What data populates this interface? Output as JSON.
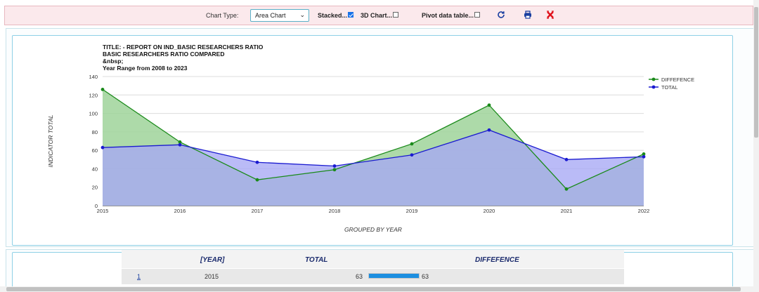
{
  "toolbar": {
    "chart_type_label": "Chart Type:",
    "chart_type_value": "Area Chart",
    "stacked_label": "Stacked...",
    "stacked_checked": true,
    "chart3d_label": "3D Chart...",
    "chart3d_checked": false,
    "pivot_label": "Pivot data table...",
    "pivot_checked": false,
    "icons": [
      "refresh-icon",
      "print-icon",
      "close-icon"
    ]
  },
  "chart": {
    "title_lines": [
      "TITLE: - REPORT ON IND_BASIC RESEARCHERS RATIO",
      "BASIC RESEARCHERS RATIO COMPARED",
      "&nbsp;",
      "Year Range from 2008 to 2023"
    ]
  },
  "chart_data": {
    "type": "area",
    "title": "TITLE: - REPORT ON IND_BASIC RESEARCHERS RATIO",
    "xlabel": "GROUPED BY YEAR",
    "ylabel": "INDICATOR TOTAL",
    "categories": [
      "2015",
      "2016",
      "2017",
      "2018",
      "2019",
      "2020",
      "2021",
      "2022"
    ],
    "ylim": [
      0,
      140
    ],
    "yticks": [
      0,
      20,
      40,
      60,
      80,
      100,
      120,
      140
    ],
    "grid": true,
    "legend_position": "top-right",
    "series": [
      {
        "name": "DIFFEFENCE",
        "color": "#1a8a1a",
        "fill": "#9fd39a",
        "values": [
          126,
          69,
          28,
          39,
          67,
          109,
          18,
          56
        ]
      },
      {
        "name": "TOTAL",
        "color": "#1a1ad0",
        "fill": "#a6a8f5",
        "values": [
          63,
          66,
          47,
          43,
          55,
          82,
          50,
          53
        ]
      }
    ]
  },
  "table": {
    "headers": [
      "[YEAR]",
      "TOTAL",
      "DIFFEFENCE"
    ],
    "rows": [
      {
        "index": "1",
        "year": "2015",
        "total": "63",
        "diff": "63",
        "bar_fraction": 1.0
      }
    ]
  }
}
